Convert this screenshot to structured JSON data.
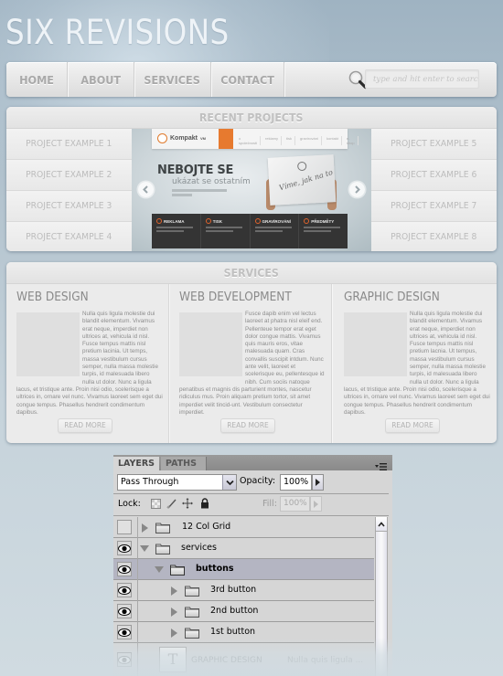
{
  "site": {
    "title": "SIX REVISIONS"
  },
  "nav": {
    "items": [
      {
        "label": "HOME"
      },
      {
        "label": "ABOUT"
      },
      {
        "label": "SERVICES"
      },
      {
        "label": "CONTACT"
      }
    ],
    "search": {
      "icon": "magnifier-icon",
      "placeholder": "type and hit enter to search",
      "value": ""
    }
  },
  "projects": {
    "heading": "RECENT PROJECTS",
    "left": [
      {
        "label": "PROJECT EXAMPLE 1"
      },
      {
        "label": "PROJECT EXAMPLE 2"
      },
      {
        "label": "PROJECT EXAMPLE 3"
      },
      {
        "label": "PROJECT EXAMPLE 4"
      }
    ],
    "right": [
      {
        "label": "PROJECT EXAMPLE 5"
      },
      {
        "label": "PROJECT EXAMPLE 6"
      },
      {
        "label": "PROJECT EXAMPLE 7"
      },
      {
        "label": "PROJECT EXAMPLE 8"
      }
    ],
    "slider": {
      "prev_icon": "chevron-left-circle-icon",
      "next_icon": "chevron-right-circle-icon",
      "screenshot": {
        "logo": "Kompakt",
        "logo_sup": "VM",
        "menu": [
          "o společnosti",
          "reklamy",
          "tisk",
          "gravírování",
          "předměty",
          "kontakt",
          "e-shop"
        ],
        "headline": "NEBOJTE SE",
        "subheadline": "ukázat se ostatním",
        "sign_text": "Víme, jak na to",
        "features": [
          {
            "title": "REKLAMA"
          },
          {
            "title": "TISK"
          },
          {
            "title": "GRAVÍROVÁNÍ"
          },
          {
            "title": "PŘEDMĚTY"
          }
        ],
        "accent_color": "#e77a2f"
      }
    }
  },
  "services": {
    "heading": "SERVICES",
    "columns": [
      {
        "title": "WEB DESIGN",
        "text": "Nulla quis ligula molestie dui blandit elementum. Vivamus erat neque, imperdiet non ultrices at, vehicula id nisl. Fusce tempus mattis nisl pretium lacinia. Ut temps, massa vestibulum cursus semper, nulla massa molestie turpis, id malesuada libero nulla ut dolor. Nunc a ligula lacus, et tristique ante. Proin nisi odio, scelerisque a ultrices in, ornare vel nunc. Vivamus laoreet sem eget dui congue tempus. Phasellus hendrerit condimentum dapibus.",
        "button": "READ MORE"
      },
      {
        "title": "WEB DEVELOPMENT",
        "text": "Fusce dapib enim vel lectus laoreet at phatra nisl eleif end. Pellenteue tempor erat eget dolor congue mattis. Vivamus quis mauris eros, vitae malesuada quam. Cras convallis suscipit intdum. Nunc ante velit, laoreet et scelerisque eu, pellentesque id nibh. Cum sociis natoque penatibus et magnis dis parturient montes, nascetur ridiculus mus. Proin aliquam pretium tortor, sit amet imperdiet velit tincid-unt. Vestibulum consectetur imperdiet.",
        "button": "READ MORE"
      },
      {
        "title": "GRAPHIC DESIGN",
        "text": "Nulla quis ligula molestie dui blandit elementum. Vivamus erat neque, imperdiet non ultrices at, vehicula id nisl. Fusce tempus mattis nisl pretium lacnia. Ut tempus, massa vestibulum cursus semper, nulla massa molestie turpis, id malesuada libero nulla ut dolor. Nunc a ligula lacus, et tristique ante. Proin nisi odio, scelerisque a ultrices in, ornare vel nunc. Vivamus laoreet sem eget dui congue tempus. Phasellus hendrerit condimentum dapibus.",
        "button": "READ MORE"
      }
    ]
  },
  "layers_panel": {
    "tabs": [
      {
        "label": "LAYERS",
        "active": true
      },
      {
        "label": "PATHS",
        "active": false
      }
    ],
    "menu_icon": "panel-menu-icon",
    "blend_mode": "Pass Through",
    "opacity_label": "Opacity:",
    "opacity_value": "100%",
    "lock_label": "Lock:",
    "lock_icons": [
      "lock-transparent-icon",
      "lock-paint-icon",
      "lock-move-icon",
      "lock-all-icon"
    ],
    "fill_label": "Fill:",
    "fill_value": "100%",
    "layers": [
      {
        "name": "12 Col Grid",
        "visible": false,
        "expanded": false,
        "indent": 0,
        "selected": false,
        "type": "group"
      },
      {
        "name": "services",
        "visible": true,
        "expanded": true,
        "indent": 0,
        "selected": false,
        "type": "group"
      },
      {
        "name": "buttons",
        "visible": true,
        "expanded": true,
        "indent": 1,
        "selected": true,
        "type": "group"
      },
      {
        "name": "3rd button",
        "visible": true,
        "expanded": false,
        "indent": 2,
        "selected": false,
        "type": "group"
      },
      {
        "name": "2nd button",
        "visible": true,
        "expanded": false,
        "indent": 2,
        "selected": false,
        "type": "group"
      },
      {
        "name": "1st button",
        "visible": true,
        "expanded": false,
        "indent": 2,
        "selected": false,
        "type": "group"
      },
      {
        "name": "GRAPHIC DESIGN",
        "extra": "Nulla quis ligula ...",
        "visible": true,
        "indent": 1,
        "selected": false,
        "type": "text",
        "thumb": "T"
      }
    ]
  }
}
